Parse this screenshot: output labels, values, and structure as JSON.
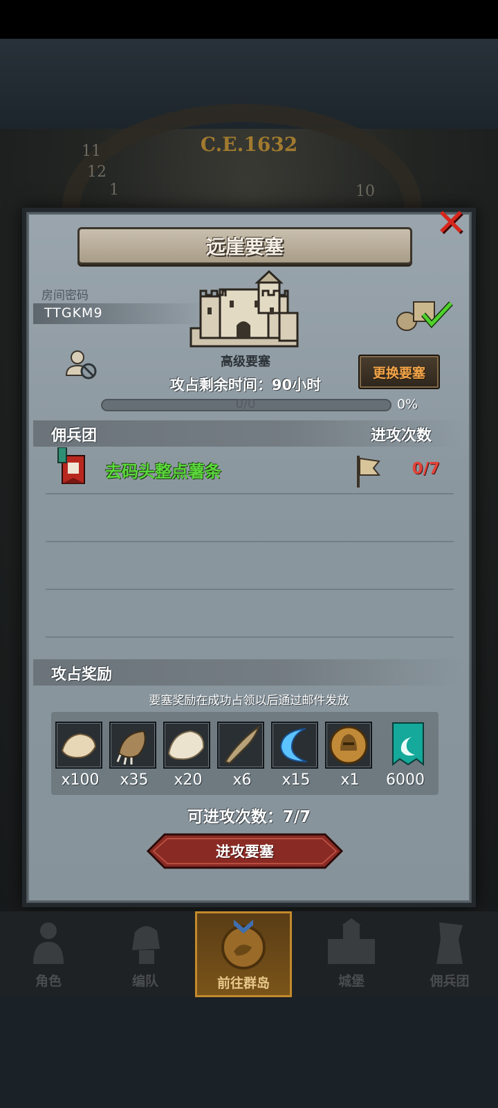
{
  "background": {
    "era_label": "C.E.1632",
    "clock_numbers": [
      "11",
      "12",
      "1",
      "10"
    ]
  },
  "dialog": {
    "title": "远崖要塞",
    "close_icon": "close-x-icon",
    "room_code_label": "房间密码",
    "room_code": "TTGKM9",
    "fortress_level": "高级要塞",
    "time_left": "攻占剩余时间：90小时",
    "progress_text": "0/0",
    "progress_percent": "0%",
    "progress_value": 0,
    "change_fortress_label": "更换要塞"
  },
  "mercenary_section": {
    "title": "佣兵团",
    "attacks_header": "进攻次数",
    "entries": [
      {
        "name": "去码头整点薯条",
        "attacks": "0/7"
      }
    ]
  },
  "reward_section": {
    "title": "攻占奖励",
    "note": "要塞奖励在成功占领以后通过邮件发放",
    "items": [
      {
        "icon": "fur-pelt-icon",
        "qty": "x100"
      },
      {
        "icon": "beast-claw-icon",
        "qty": "x35"
      },
      {
        "icon": "white-pelt-icon",
        "qty": "x20"
      },
      {
        "icon": "horn-icon",
        "qty": "x6"
      },
      {
        "icon": "blue-crescent-icon",
        "qty": "x15"
      },
      {
        "icon": "knight-helmet-medal-icon",
        "qty": "x1"
      },
      {
        "icon": "guild-banner-icon",
        "qty": "6000"
      }
    ],
    "attempts": "可进攻次数：7/7",
    "attack_button": "进攻要塞"
  },
  "nav": {
    "items": [
      {
        "label": "角色",
        "icon": "character-icon"
      },
      {
        "label": "编队",
        "icon": "formation-icon"
      },
      {
        "label": "前往群岛",
        "icon": "islands-icon",
        "active": true
      },
      {
        "label": "城堡",
        "icon": "castle-icon"
      },
      {
        "label": "佣兵团",
        "icon": "mercenary-icon"
      }
    ]
  },
  "colors": {
    "panel": "#8f9ba3",
    "merc_name": "#5bd83c",
    "attack_count": "#e2433a",
    "change_btn_text": "#f2a54a",
    "attack_btn": "#8a2a24",
    "nav_active": "#c48a2c"
  }
}
